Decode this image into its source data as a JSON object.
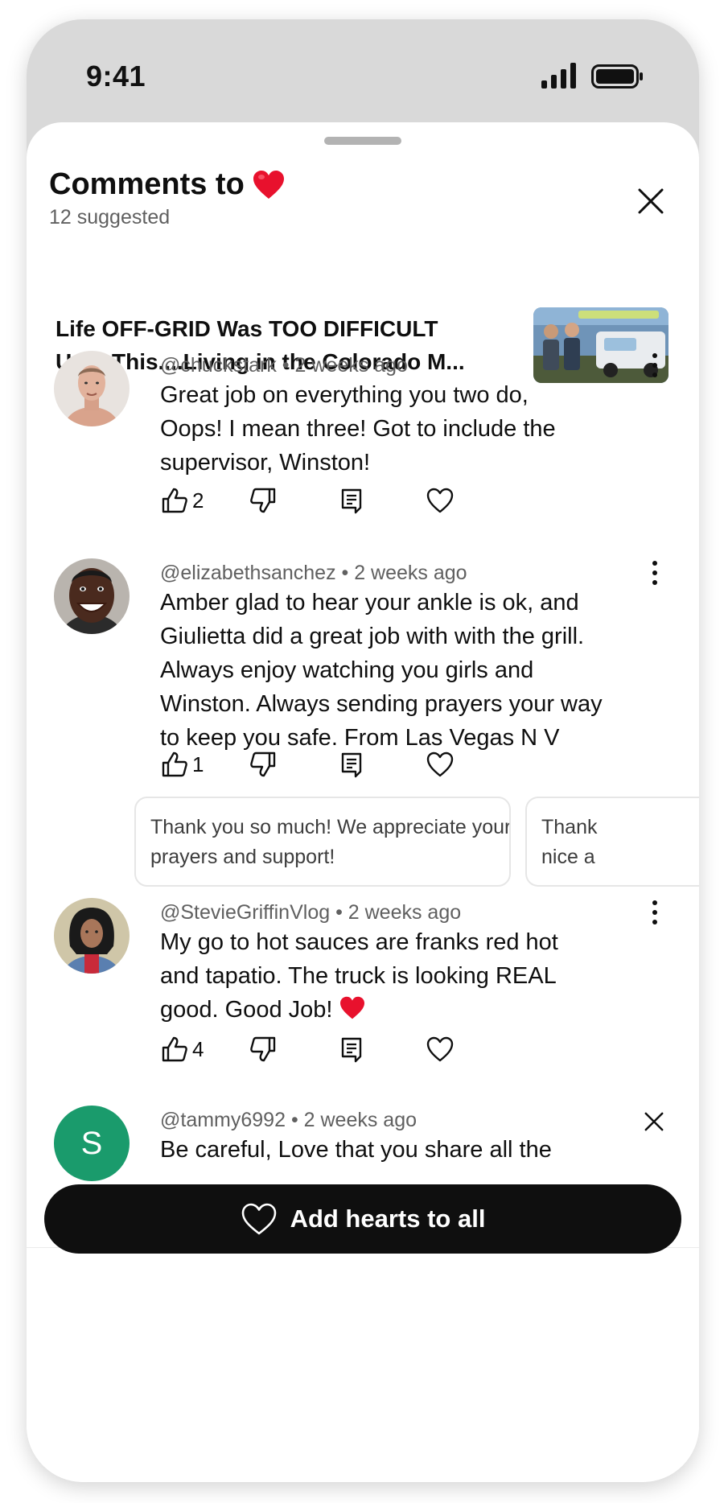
{
  "status_bar": {
    "time": "9:41"
  },
  "sheet": {
    "title": "Comments to",
    "subtitle": "12 suggested"
  },
  "video": {
    "title_line1": "Life OFF-GRID Was TOO DIFFICULT",
    "title_line2": "Until This....Living in the Colorado M..."
  },
  "comments": [
    {
      "author": "@chuckstark",
      "time": "2 weeks ago",
      "meta": "@chuckstark • 2 weeks ago",
      "lines": [
        "Great job on everything you two do,",
        "Oops! I mean three! Got to include the",
        "supervisor, Winston!"
      ],
      "likes": "2"
    },
    {
      "author": "@elizabethsanchez",
      "time": "2 weeks ago",
      "meta": "@elizabethsanchez • 2 weeks ago",
      "lines": [
        "Amber glad to hear your ankle is ok, and",
        "Giulietta did a great job with with the grill.",
        "Always enjoy watching you girls and",
        "Winston. Always sending prayers your way",
        "to keep you safe. From Las Vegas N V"
      ],
      "likes": "1",
      "suggested_replies": [
        {
          "line1": "Thank you so much! We appreciate your",
          "line2": "prayers and support!"
        },
        {
          "line1": "Thank",
          "line2": "nice a"
        }
      ]
    },
    {
      "author": "@StevieGriffinVlog",
      "time": "2 weeks ago",
      "meta": "@StevieGriffinVlog • 2 weeks ago",
      "lines": [
        "My go to hot sauces are franks red hot",
        "and tapatio. The truck is looking REAL",
        "good. Good Job!"
      ],
      "likes": "4"
    },
    {
      "author": "@tammy6992",
      "time": "2 weeks ago",
      "meta": "@tammy6992 • 2 weeks ago",
      "avatar_letter": "S",
      "lines": [
        "Be careful, Love that you share all the"
      ]
    }
  ],
  "bottom": {
    "add_hearts_label": "Add hearts to all"
  },
  "colors": {
    "heart_red": "#e8112d",
    "button_bg": "#0f0f0f",
    "avatar_green": "#1a9b6c",
    "secondary_text": "#606060"
  },
  "icons": [
    "signal-icon",
    "battery-icon",
    "heart-emoji-icon",
    "close-icon",
    "kebab-menu-icon",
    "thumbs-up-icon",
    "thumbs-down-icon",
    "reply-icon",
    "heart-outline-icon"
  ]
}
